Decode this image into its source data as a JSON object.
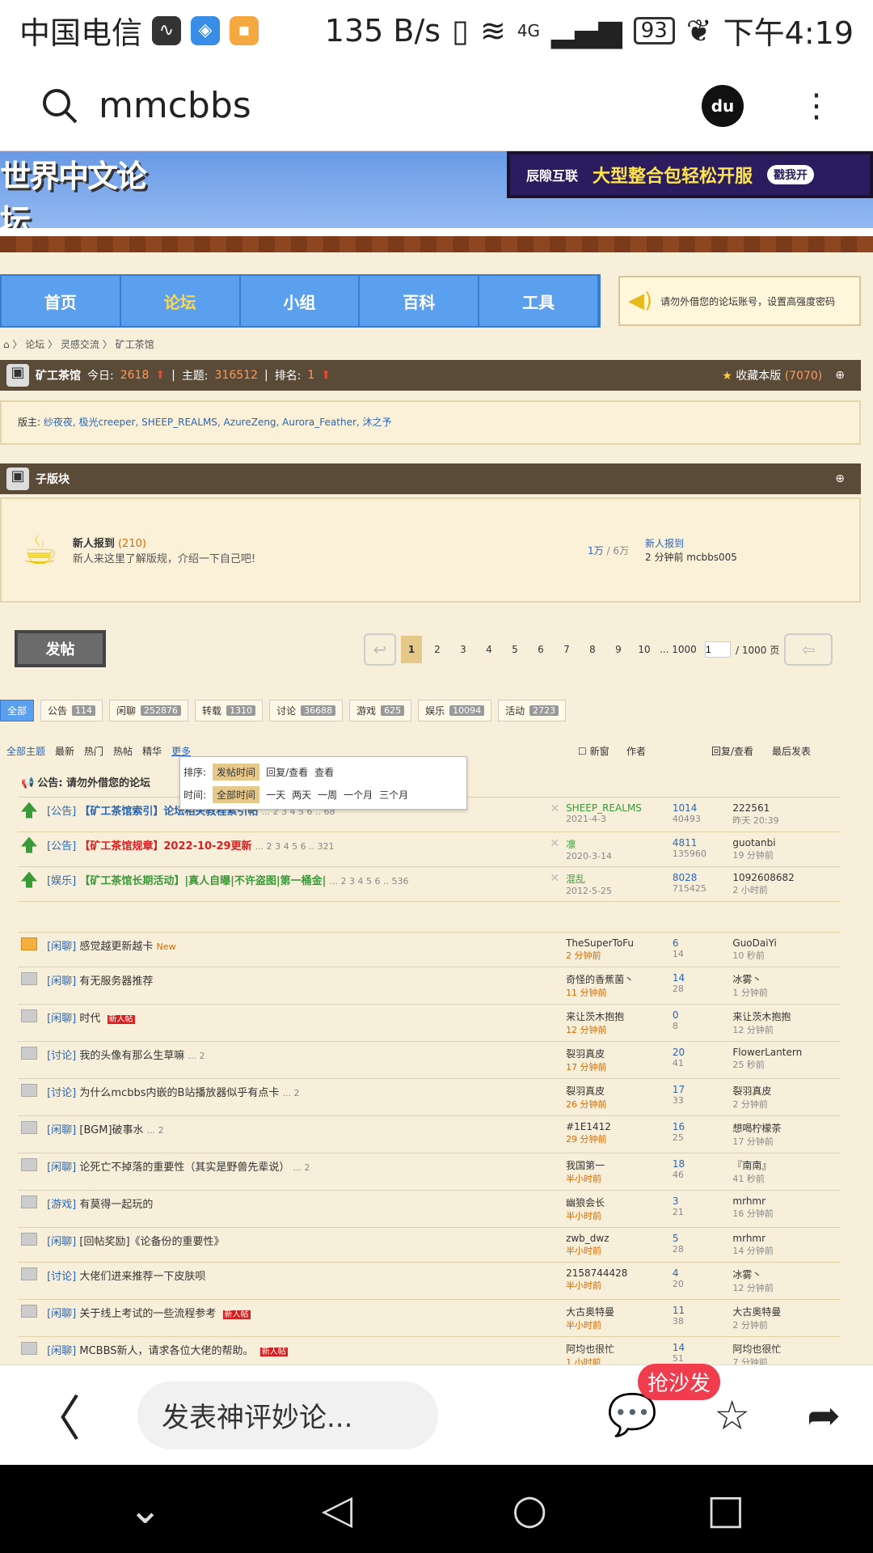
{
  "status": {
    "carrier": "中国电信",
    "speed": "135 B/s",
    "net": "4G",
    "battery": "93",
    "time": "下午4:19"
  },
  "search": {
    "query": "mmcbbs"
  },
  "banner": {
    "logo": "世界中文论坛",
    "ad_brand": "辰隙互联",
    "ad_text": "大型整合包轻松开服",
    "ad_btn": "戳我开"
  },
  "nav": {
    "items": [
      "首页",
      "论坛",
      "小组",
      "百科",
      "工具"
    ]
  },
  "notice": "请勿外借您的论坛账号，设置高强度密码",
  "breadcrumb": [
    "论坛",
    "灵感交流",
    "矿工茶馆"
  ],
  "forum": {
    "name": "矿工茶馆",
    "today_label": "今日:",
    "today": "2618",
    "topics_label": "主题:",
    "topics": "316512",
    "rank_label": "排名:",
    "rank": "1",
    "fav": "收藏本版",
    "fav_count": "(7070)"
  },
  "mods": {
    "label": "版主:",
    "names": "纱夜夜, 极光creeper, SHEEP_REALMS, AzureZeng, Aurora_Feather, 沐之予"
  },
  "subforum": {
    "title": "子版块",
    "name": "新人报到",
    "count": "(210)",
    "desc": "新人来这里了解版规，介绍一下自己吧!",
    "stats_a": "1万",
    "stats_b": "/ 6万",
    "last_title": "新人报到",
    "last_info": "2 分钟前 mcbbs005"
  },
  "post_btn": "发帖",
  "pager": {
    "pages": [
      "1",
      "2",
      "3",
      "4",
      "5",
      "6",
      "7",
      "8",
      "9",
      "10",
      "... 1000"
    ],
    "input": "1",
    "total": "/ 1000 页"
  },
  "cats": [
    {
      "name": "全部",
      "n": ""
    },
    {
      "name": "公告",
      "n": "114"
    },
    {
      "name": "闲聊",
      "n": "252876"
    },
    {
      "name": "转载",
      "n": "1310"
    },
    {
      "name": "讨论",
      "n": "36688"
    },
    {
      "name": "游戏",
      "n": "625"
    },
    {
      "name": "娱乐",
      "n": "10094"
    },
    {
      "name": "活动",
      "n": "2723"
    }
  ],
  "filter": {
    "all": "全部主题",
    "newest": "最新",
    "hot": "热门",
    "hottalk": "热帖",
    "digest": "精华",
    "more": "更多",
    "newwin": "新窗",
    "author": "作者",
    "reply": "回复/查看",
    "last": "最后发表"
  },
  "dropdown": {
    "sort_label": "排序:",
    "sort": [
      "发帖时间",
      "回复/查看",
      "查看"
    ],
    "time_label": "时间:",
    "time": [
      "全部时间",
      "一天",
      "两天",
      "一周",
      "一个月",
      "三个月"
    ]
  },
  "announce": "公告: 请勿外借您的论坛",
  "threads": [
    {
      "tag": "[公告]",
      "title": "【矿工茶馆索引】论坛相关教程索引帖",
      "pages": "... 2 3 4 5 6 .. 68",
      "author": "SHEEP_REALMS",
      "date": "2021-4-3",
      "replies": "1014",
      "views": "40493",
      "last": "222561",
      "lasttime": "昨天 20:39",
      "style": "blue",
      "icon": "up"
    },
    {
      "tag": "[公告]",
      "title": "【矿工茶馆规章】2022-10-29更新",
      "pages": "... 2 3 4 5 6 .. 321",
      "author": "凛",
      "date": "2020-3-14",
      "replies": "4811",
      "views": "135960",
      "last": "guotanbi",
      "lasttime": "19 分钟前",
      "style": "red",
      "icon": "up"
    },
    {
      "tag": "[娱乐]",
      "title": "【矿工茶馆长期活动】|真人自曝|不许盗图|第一桶金|",
      "pages": "... 2 3 4 5 6 .. 536",
      "author": "混乱",
      "date": "2012-5-25",
      "replies": "8028",
      "views": "715425",
      "last": "1092608682",
      "lasttime": "2 小时前",
      "style": "green",
      "icon": "up"
    },
    {
      "tag": "[闲聊]",
      "title": "感觉越更新越卡",
      "pages": "New",
      "author": "TheSuperToFu",
      "date": "2 分钟前",
      "replies": "6",
      "views": "14",
      "last": "GuoDaiYi",
      "lasttime": "10 秒前",
      "style": "",
      "icon": "hot"
    },
    {
      "tag": "[闲聊]",
      "title": "有无服务器推荐",
      "pages": "",
      "author": "奇怪的香蕉菌丶",
      "date": "11 分钟前",
      "replies": "14",
      "views": "28",
      "last": "冰雾丶",
      "lasttime": "1 分钟前",
      "style": "",
      "icon": "f"
    },
    {
      "tag": "[闲聊]",
      "title": "时代",
      "pages": "新人帖",
      "author": "来让茨木抱抱",
      "date": "12 分钟前",
      "replies": "0",
      "views": "8",
      "last": "来让茨木抱抱",
      "lasttime": "12 分钟前",
      "style": "",
      "icon": "f"
    },
    {
      "tag": "[讨论]",
      "title": "我的头像有那么生草嘛",
      "pages": "... 2",
      "author": "裂羽真皮",
      "date": "17 分钟前",
      "replies": "20",
      "views": "41",
      "last": "FlowerLantern",
      "lasttime": "25 秒前",
      "style": "",
      "icon": "f"
    },
    {
      "tag": "[讨论]",
      "title": "为什么mcbbs内嵌的B站播放器似乎有点卡",
      "pages": "... 2",
      "author": "裂羽真皮",
      "date": "26 分钟前",
      "replies": "17",
      "views": "33",
      "last": "裂羽真皮",
      "lasttime": "2 分钟前",
      "style": "",
      "icon": "f"
    },
    {
      "tag": "[闲聊]",
      "title": "[BGM]破事水",
      "pages": "... 2",
      "author": "#1E1412",
      "date": "29 分钟前",
      "replies": "16",
      "views": "25",
      "last": "想喝柠檬茶",
      "lasttime": "17 分钟前",
      "style": "",
      "icon": "f"
    },
    {
      "tag": "[闲聊]",
      "title": "论死亡不掉落的重要性（其实是野兽先辈说）",
      "pages": "... 2",
      "author": "我国第一",
      "date": "半小时前",
      "replies": "18",
      "views": "46",
      "last": "『南南』",
      "lasttime": "41 秒前",
      "style": "",
      "icon": "f"
    },
    {
      "tag": "[游戏]",
      "title": "有莫得一起玩的",
      "pages": "",
      "author": "幽狼会长",
      "date": "半小时前",
      "replies": "3",
      "views": "21",
      "last": "mrhmr",
      "lasttime": "16 分钟前",
      "style": "",
      "icon": "f"
    },
    {
      "tag": "[闲聊]",
      "title": "[回帖奖励]《论备份的重要性》",
      "pages": "",
      "author": "zwb_dwz",
      "date": "半小时前",
      "replies": "5",
      "views": "28",
      "last": "mrhmr",
      "lasttime": "14 分钟前",
      "style": "",
      "icon": "f"
    },
    {
      "tag": "[讨论]",
      "title": "大佬们进来推荐一下皮肤呗",
      "pages": "",
      "author": "2158744428",
      "date": "半小时前",
      "replies": "4",
      "views": "20",
      "last": "冰雾丶",
      "lasttime": "12 分钟前",
      "style": "",
      "icon": "f"
    },
    {
      "tag": "[闲聊]",
      "title": "关于线上考试的一些流程参考",
      "pages": "新人帖",
      "author": "大古奥特曼",
      "date": "半小时前",
      "replies": "11",
      "views": "38",
      "last": "大古奥特曼",
      "lasttime": "2 分钟前",
      "style": "",
      "icon": "f"
    },
    {
      "tag": "[闲聊]",
      "title": "MCBBS新人，请求各位大佬的帮助。",
      "pages": "新人帖",
      "author": "阿均也很忙",
      "date": "1 小时前",
      "replies": "14",
      "views": "51",
      "last": "阿均也很忙",
      "lasttime": "7 分钟前",
      "style": "",
      "icon": "f"
    }
  ],
  "bottom": {
    "comment": "发表神评妙论...",
    "badge": "抢沙发"
  }
}
